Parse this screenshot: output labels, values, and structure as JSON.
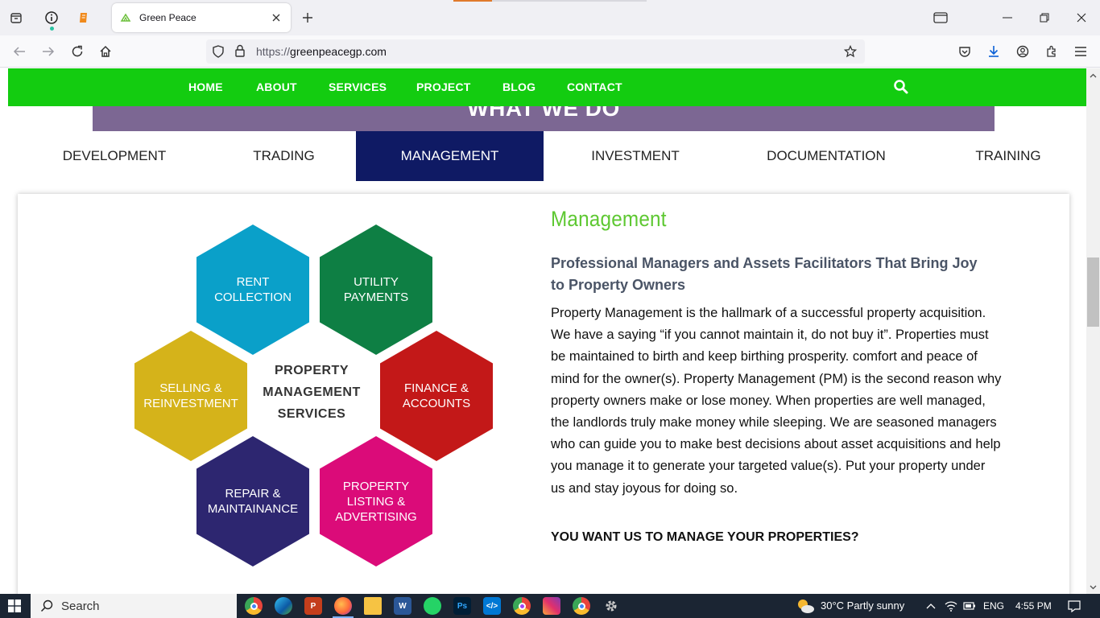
{
  "browser": {
    "tab_title": "Green Peace",
    "url_prefix": "https://",
    "url_domain": "greenpeacegp.com"
  },
  "site_nav": {
    "items": [
      "HOME",
      "ABOUT",
      "SERVICES",
      "PROJECT",
      "BLOG",
      "CONTACT"
    ]
  },
  "section_title": "WHAT WE DO",
  "service_tabs": {
    "items": [
      "DEVELOPMENT",
      "TRADING",
      "MANAGEMENT",
      "INVESTMENT",
      "DOCUMENTATION",
      "TRAINING"
    ],
    "active": "MANAGEMENT"
  },
  "diagram": {
    "center": [
      "PROPERTY",
      "MANAGEMENT",
      "SERVICES"
    ],
    "hexes": [
      {
        "label": "RENT COLLECTION",
        "color": "#0aa0c9"
      },
      {
        "label": "UTILITY PAYMENTS",
        "color": "#0e7f44"
      },
      {
        "label": "SELLING & REINVESTMENT",
        "color": "#d5b31a"
      },
      {
        "label": "FINANCE & ACCOUNTS",
        "color": "#c31818"
      },
      {
        "label": "REPAIR & MAINTAINANCE",
        "color": "#2d2670"
      },
      {
        "label": "PROPERTY LISTING & ADVERTISING",
        "color": "#db0b79"
      }
    ]
  },
  "content": {
    "heading": "Management",
    "subheading": "Professional Managers and Assets Facilitators That Bring Joy to Property Owners",
    "body": "Property Management is the hallmark of a successful property acquisition. We have a saying “if you cannot maintain it, do not buy it”. Properties must be maintained to birth and keep birthing prosperity. comfort and peace of mind for the owner(s). Property Management (PM) is the second reason why property owners make or lose money. When properties are well managed, the landlords truly make money while sleeping. We are seasoned managers who can guide you to make best decisions about asset acquisitions and help you manage it to generate your targeted value(s). Put your property under us and stay joyous for doing so.",
    "cta": "YOU WANT US TO MANAGE YOUR PROPERTIES?"
  },
  "taskbar": {
    "search_label": "Search",
    "weather": "30°C  Partly sunny",
    "language": "ENG",
    "time": "4:55 PM",
    "apps": [
      "chrome-icon",
      "edge-icon",
      "powerpoint-icon",
      "firefox-icon",
      "file-explorer-icon",
      "word-icon",
      "whatsapp-icon",
      "photoshop-icon",
      "vscode-icon",
      "chrome-profile-icon",
      "instagram-icon",
      "chrome-alt-icon",
      "settings-icon"
    ]
  },
  "colors": {
    "nav_green": "#13cc10",
    "section_purple": "#7c6793",
    "active_tab_navy": "#0f1a64",
    "heading_green": "#5ec832"
  }
}
